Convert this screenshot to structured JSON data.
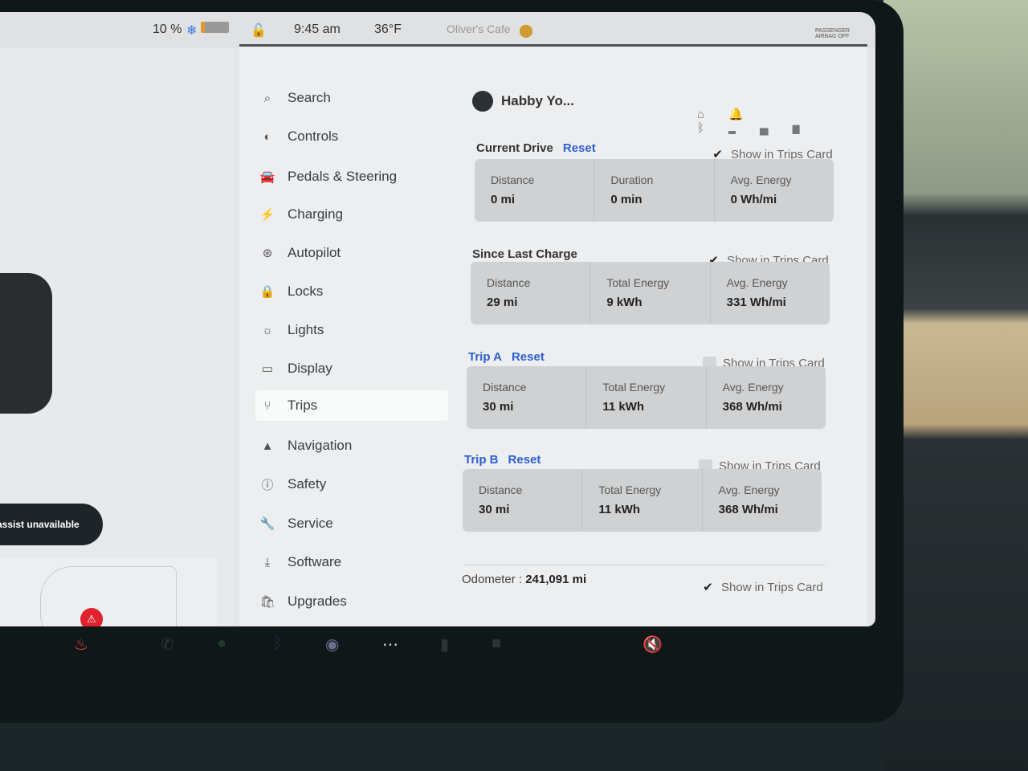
{
  "status": {
    "battery": "10 %",
    "time": "9:45 am",
    "temperature": "36°F",
    "map_poi": "Oliver's Cafe",
    "airbag_label": "PASSENGER AIRBAG OFF"
  },
  "left": {
    "alert": "assist unavailable"
  },
  "menu": [
    {
      "label": "Search",
      "icon": "search"
    },
    {
      "label": "Controls",
      "icon": "toggle"
    },
    {
      "label": "Pedals & Steering",
      "icon": "car"
    },
    {
      "label": "Charging",
      "icon": "bolt"
    },
    {
      "label": "Autopilot",
      "icon": "steering-wheel"
    },
    {
      "label": "Locks",
      "icon": "lock"
    },
    {
      "label": "Lights",
      "icon": "sun"
    },
    {
      "label": "Display",
      "icon": "display"
    },
    {
      "label": "Trips",
      "icon": "trips",
      "active": true
    },
    {
      "label": "Navigation",
      "icon": "navigation"
    },
    {
      "label": "Safety",
      "icon": "alert-circle"
    },
    {
      "label": "Service",
      "icon": "wrench"
    },
    {
      "label": "Software",
      "icon": "download"
    },
    {
      "label": "Upgrades",
      "icon": "bag"
    }
  ],
  "profile": {
    "name": "Habby Yo..."
  },
  "sections": [
    {
      "title": "Current Drive",
      "reset": "Reset",
      "show_label": "Show in Trips Card",
      "checked": true,
      "cells": [
        {
          "label": "Distance",
          "value": "0 mi"
        },
        {
          "label": "Duration",
          "value": "0 min"
        },
        {
          "label": "Avg. Energy",
          "value": "0 Wh/mi"
        }
      ]
    },
    {
      "title": "Since Last Charge",
      "show_label": "Show in Trips Card",
      "checked": true,
      "cells": [
        {
          "label": "Distance",
          "value": "29 mi"
        },
        {
          "label": "Total Energy",
          "value": "9 kWh"
        },
        {
          "label": "Avg. Energy",
          "value": "331 Wh/mi"
        }
      ]
    },
    {
      "title": "Trip A",
      "reset": "Reset",
      "show_label": "Show in Trips Card",
      "checked": false,
      "cells": [
        {
          "label": "Distance",
          "value": "30 mi"
        },
        {
          "label": "Total Energy",
          "value": "11 kWh"
        },
        {
          "label": "Avg. Energy",
          "value": "368 Wh/mi"
        }
      ]
    },
    {
      "title": "Trip B",
      "reset": "Reset",
      "show_label": "Show in Trips Card",
      "checked": false,
      "cells": [
        {
          "label": "Distance",
          "value": "30 mi"
        },
        {
          "label": "Total Energy",
          "value": "11 kWh"
        },
        {
          "label": "Avg. Energy",
          "value": "368 Wh/mi"
        }
      ]
    }
  ],
  "odometer": {
    "label": "Odometer",
    "value": "241,091 mi",
    "show_label": "Show in Trips Card",
    "checked": true
  },
  "colors": {
    "accent": "#2f5fd0",
    "alert": "#e0222e"
  }
}
